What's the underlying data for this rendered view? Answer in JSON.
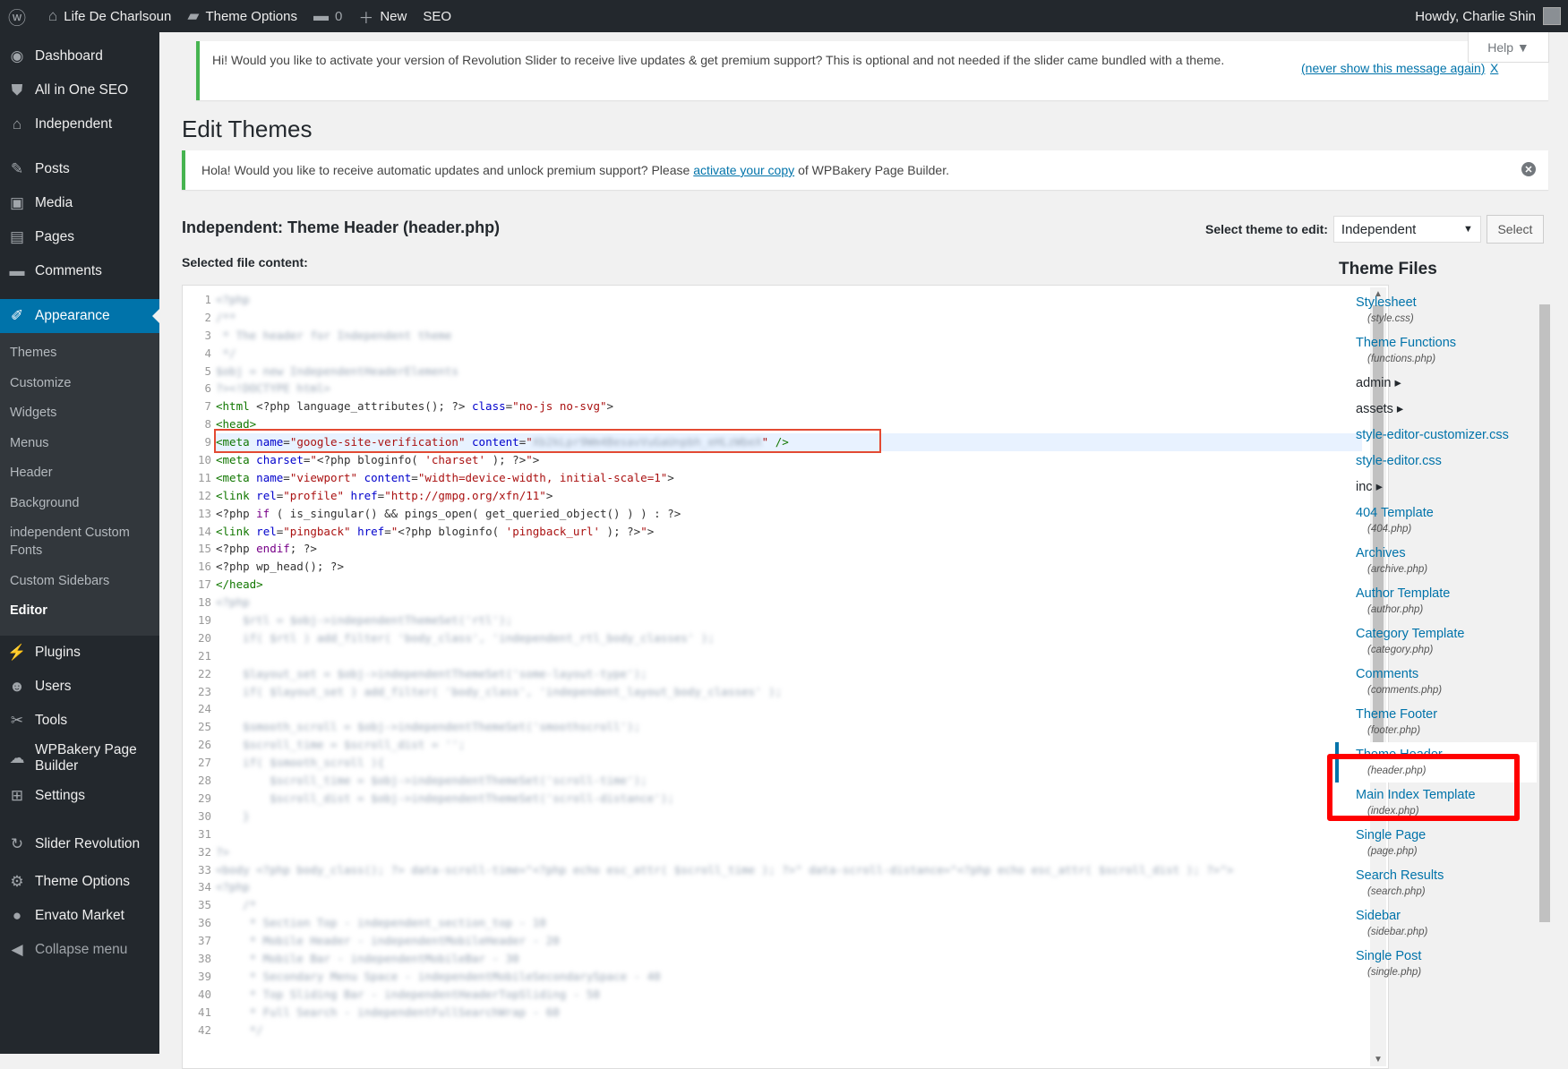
{
  "adminbar": {
    "site_name": "Life De Charlsoun",
    "theme_options": "Theme Options",
    "comments_count": "0",
    "new_label": "New",
    "seo_label": "SEO",
    "howdy": "Howdy, Charlie Shin"
  },
  "sidebar": {
    "items_top": [
      {
        "icon": "dashboard-icon",
        "glyph": "◉",
        "label": "Dashboard"
      },
      {
        "icon": "seo-shield-icon",
        "glyph": "⛊",
        "label": "All in One SEO"
      },
      {
        "icon": "home-icon",
        "glyph": "⌂",
        "label": "Independent"
      }
    ],
    "items_mid": [
      {
        "icon": "pin-icon",
        "glyph": "✎",
        "label": "Posts"
      },
      {
        "icon": "media-icon",
        "glyph": "▣",
        "label": "Media"
      },
      {
        "icon": "pages-icon",
        "glyph": "▤",
        "label": "Pages"
      },
      {
        "icon": "comments-icon",
        "glyph": "▬",
        "label": "Comments"
      }
    ],
    "appearance": {
      "icon": "brush-icon",
      "glyph": "✐",
      "label": "Appearance"
    },
    "submenu": [
      "Themes",
      "Customize",
      "Widgets",
      "Menus",
      "Header",
      "Background",
      "independent Custom Fonts",
      "Custom Sidebars",
      "Editor"
    ],
    "items_low": [
      {
        "icon": "plugin-icon",
        "glyph": "⚡",
        "label": "Plugins"
      },
      {
        "icon": "users-icon",
        "glyph": "☻",
        "label": "Users"
      },
      {
        "icon": "tools-icon",
        "glyph": "✂",
        "label": "Tools"
      },
      {
        "icon": "wpbakery-icon",
        "glyph": "☁",
        "label": "WPBakery Page Builder"
      },
      {
        "icon": "settings-icon",
        "glyph": "⊞",
        "label": "Settings"
      }
    ],
    "items_bottom": [
      {
        "icon": "refresh-icon",
        "glyph": "↻",
        "label": "Slider Revolution"
      },
      {
        "icon": "gear-icon",
        "glyph": "⚙",
        "label": "Theme Options"
      },
      {
        "icon": "leaf-icon",
        "glyph": "●",
        "label": "Envato Market"
      },
      {
        "icon": "collapse-icon",
        "glyph": "◀",
        "label": "Collapse menu"
      }
    ]
  },
  "notice1": {
    "text": "Hi! Would you like to activate your version of Revolution Slider to receive live updates & get premium support? This is optional and not needed if the slider came bundled with a theme.",
    "never": "(never show this message again)",
    "x": "X"
  },
  "help": "Help ▼",
  "page_title": "Edit Themes",
  "notice2": {
    "pre": "Hola! Would you like to receive automatic updates and unlock premium support? Please",
    "link": "activate your copy",
    "post": "of WPBakery Page Builder."
  },
  "file_title": "Independent: Theme Header (header.php)",
  "select_label": "Select theme to edit:",
  "select_value": "Independent",
  "select_button": "Select",
  "selected_file_content": "Selected file content:",
  "theme_files_title": "Theme Files",
  "theme_files": [
    {
      "name": "Stylesheet",
      "file": "(style.css)"
    },
    {
      "name": "Theme Functions",
      "file": "(functions.php)"
    },
    {
      "name": "admin ▸",
      "file": "",
      "dir": true
    },
    {
      "name": "assets ▸",
      "file": "",
      "dir": true
    },
    {
      "name": "style-editor-customizer.css",
      "file": ""
    },
    {
      "name": "style-editor.css",
      "file": ""
    },
    {
      "name": "inc ▸",
      "file": "",
      "dir": true
    },
    {
      "name": "404 Template",
      "file": "(404.php)"
    },
    {
      "name": "Archives",
      "file": "(archive.php)"
    },
    {
      "name": "Author Template",
      "file": "(author.php)"
    },
    {
      "name": "Category Template",
      "file": "(category.php)"
    },
    {
      "name": "Comments",
      "file": "(comments.php)"
    },
    {
      "name": "Theme Footer",
      "file": "(footer.php)"
    },
    {
      "name": "Theme Header",
      "file": "(header.php)",
      "current": true
    },
    {
      "name": "Main Index Template",
      "file": "(index.php)"
    },
    {
      "name": "Single Page",
      "file": "(page.php)"
    },
    {
      "name": "Search Results",
      "file": "(search.php)"
    },
    {
      "name": "Sidebar",
      "file": "(sidebar.php)"
    },
    {
      "name": "Single Post",
      "file": "(single.php)"
    }
  ],
  "code_lines": [
    {
      "n": 1,
      "blur": true,
      "text": "<?php"
    },
    {
      "n": 2,
      "blur": true,
      "text": "/**"
    },
    {
      "n": 3,
      "blur": true,
      "text": " * The header for Independent theme"
    },
    {
      "n": 4,
      "blur": true,
      "text": " */"
    },
    {
      "n": 5,
      "blur": true,
      "text": "$obj = new IndependentHeaderElements"
    },
    {
      "n": 6,
      "blur": true,
      "text": "?><!DOCTYPE html>"
    },
    {
      "n": 7,
      "html": "<span class=\"t\">&lt;html</span> &lt;?php language_attributes(); ?&gt; <span class=\"a\">class</span>=<span class=\"s\">\"no-js no-svg\"</span>&gt;"
    },
    {
      "n": 8,
      "html": "<span class=\"t\">&lt;head&gt;</span>"
    },
    {
      "n": 9,
      "hl": true,
      "html": "<span class=\"t\">&lt;meta</span> <span class=\"a\">name</span>=<span class=\"s\">\"google-site-verification\"</span> <span class=\"a\">content</span>=<span class=\"s\">\"</span><span class=\"s blurline\">Xb2kLpr9Wm4BesavVuGaUnpbh_eHLzWbeX</span><span class=\"s\">\"</span> <span class=\"t\">/&gt;</span>"
    },
    {
      "n": 10,
      "html": "<span class=\"t\">&lt;meta</span> <span class=\"a\">charset</span>=<span class=\"s\">\"</span>&lt;?php bloginfo( <span class=\"s\">'charset'</span> ); ?&gt;<span class=\"s\">\"</span>&gt;"
    },
    {
      "n": 11,
      "html": "<span class=\"t\">&lt;meta</span> <span class=\"a\">name</span>=<span class=\"s\">\"viewport\"</span> <span class=\"a\">content</span>=<span class=\"s\">\"width=device-width, initial-scale=1\"</span>&gt;"
    },
    {
      "n": 12,
      "html": "<span class=\"t\">&lt;link</span> <span class=\"a\">rel</span>=<span class=\"s\">\"profile\"</span> <span class=\"a\">href</span>=<span class=\"s\">\"http://gmpg.org/xfn/11\"</span>&gt;"
    },
    {
      "n": 13,
      "html": "&lt;?php <span class=\"k\">if</span> ( is_singular() &amp;&amp; pings_open( get_queried_object() ) ) : ?&gt;"
    },
    {
      "n": 14,
      "html": "<span class=\"t\">&lt;link</span> <span class=\"a\">rel</span>=<span class=\"s\">\"pingback\"</span> <span class=\"a\">href</span>=<span class=\"s\">\"</span>&lt;?php bloginfo( <span class=\"s\">'pingback_url'</span> ); ?&gt;<span class=\"s\">\"</span>&gt;"
    },
    {
      "n": 15,
      "html": "&lt;?php <span class=\"k\">endif</span>; ?&gt;"
    },
    {
      "n": 16,
      "html": "&lt;?php wp_head(); ?&gt;"
    },
    {
      "n": 17,
      "html": "<span class=\"t\">&lt;/head&gt;</span>"
    },
    {
      "n": 18,
      "blur": true,
      "text": "<?php"
    },
    {
      "n": 19,
      "blur": true,
      "text": "    $rtl = $obj->independentThemeSet('rtl');"
    },
    {
      "n": 20,
      "blur": true,
      "text": "    if( $rtl ) add_filter( 'body_class', 'independent_rtl_body_classes' );"
    },
    {
      "n": 21,
      "blur": true,
      "text": ""
    },
    {
      "n": 22,
      "blur": true,
      "text": "    $layout_set = $obj->independentThemeSet('some-layout-type');"
    },
    {
      "n": 23,
      "blur": true,
      "text": "    if( $layout_set ) add_filter( 'body_class', 'independent_layout_body_classes' );"
    },
    {
      "n": 24,
      "blur": true,
      "text": ""
    },
    {
      "n": 25,
      "blur": true,
      "text": "    $smooth_scroll = $obj->independentThemeSet('smoothscroll');"
    },
    {
      "n": 26,
      "blur": true,
      "text": "    $scroll_time = $scroll_dist = '';"
    },
    {
      "n": 27,
      "blur": true,
      "text": "    if( $smooth_scroll ){"
    },
    {
      "n": 28,
      "blur": true,
      "text": "        $scroll_time = $obj->independentThemeSet('scroll-time');"
    },
    {
      "n": 29,
      "blur": true,
      "text": "        $scroll_dist = $obj->independentThemeSet('scroll-distance');"
    },
    {
      "n": 30,
      "blur": true,
      "text": "    }"
    },
    {
      "n": 31,
      "blur": true,
      "text": ""
    },
    {
      "n": 32,
      "blur": true,
      "text": "?>"
    },
    {
      "n": 33,
      "blur": true,
      "text": "<body <?php body_class(); ?> data-scroll-time=\"<?php echo esc_attr( $scroll_time ); ?>\" data-scroll-distance=\"<?php echo esc_attr( $scroll_dist ); ?>\">"
    },
    {
      "n": 34,
      "blur": true,
      "text": "<?php"
    },
    {
      "n": 35,
      "blur": true,
      "text": "    /*"
    },
    {
      "n": 36,
      "blur": true,
      "text": "     * Section Top - independent_section_top - 10"
    },
    {
      "n": 37,
      "blur": true,
      "text": "     * Mobile Header - independentMobileHeader - 20"
    },
    {
      "n": 38,
      "blur": true,
      "text": "     * Mobile Bar - independentMobileBar - 30"
    },
    {
      "n": 39,
      "blur": true,
      "text": "     * Secondary Menu Space - independentMobileSecondarySpace - 40"
    },
    {
      "n": 40,
      "blur": true,
      "text": "     * Top Sliding Bar - independentHeaderTopSliding - 50"
    },
    {
      "n": 41,
      "blur": true,
      "text": "     * Full Search - independentFullSearchWrap - 60"
    },
    {
      "n": 42,
      "blur": true,
      "text": "     */"
    }
  ]
}
